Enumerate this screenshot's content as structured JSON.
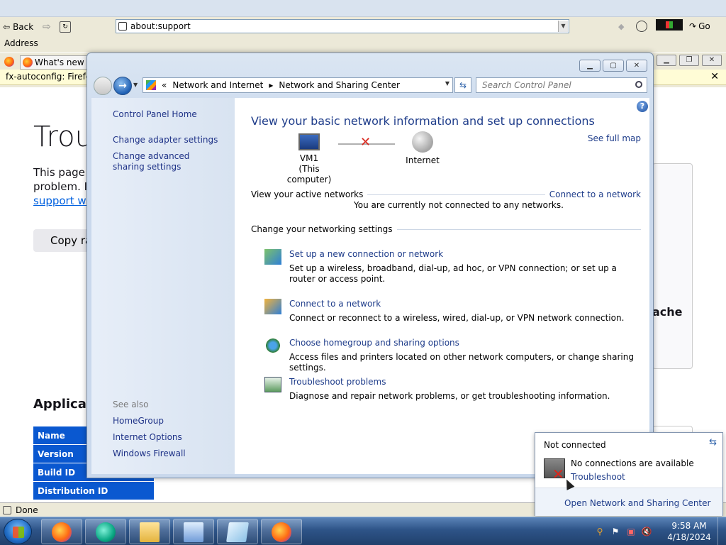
{
  "browser": {
    "back_label": "Back",
    "go_label": "Go",
    "address_label": "Address",
    "url": "about:support",
    "tab_title": "What's new w",
    "notification": "fx-autoconfig: Firefox",
    "status": "Done"
  },
  "support_page": {
    "title": "Troub",
    "intro_line1": "This page c",
    "intro_line2": "problem. If",
    "intro_link": "support we",
    "copy_button": "Copy ra",
    "right_panel_text": "ache",
    "section_heading": "Applicati",
    "table_rows": [
      "Name",
      "Version",
      "Build ID",
      "Distribution ID"
    ]
  },
  "control_panel": {
    "breadcrumb_prefix": "«",
    "breadcrumb": [
      "Network and Internet",
      "Network and Sharing Center"
    ],
    "search_placeholder": "Search Control Panel",
    "side_links": [
      "Control Panel Home",
      "Change adapter settings",
      "Change advanced sharing settings"
    ],
    "see_also_heading": "See also",
    "see_also_links": [
      "HomeGroup",
      "Internet Options",
      "Windows Firewall"
    ],
    "main_title": "View your basic network information and set up connections",
    "see_full_map": "See full map",
    "computer_name": "VM1",
    "computer_sub": "(This computer)",
    "internet_label": "Internet",
    "active_networks_label": "View your active networks",
    "connect_link": "Connect to a network",
    "not_connected_msg": "You are currently not connected to any networks.",
    "change_settings_label": "Change your networking settings",
    "tasks": [
      {
        "link": "Set up a new connection or network",
        "desc": "Set up a wireless, broadband, dial-up, ad hoc, or VPN connection; or set up a router or access point."
      },
      {
        "link": "Connect to a network",
        "desc": "Connect or reconnect to a wireless, wired, dial-up, or VPN network connection."
      },
      {
        "link": "Choose homegroup and sharing options",
        "desc": "Access files and printers located on other network computers, or change sharing settings."
      },
      {
        "link": "Troubleshoot problems",
        "desc": "Diagnose and repair network problems, or get troubleshooting information."
      }
    ]
  },
  "network_popup": {
    "title": "Not connected",
    "message": "No connections are available",
    "troubleshoot_link": "Troubleshoot",
    "footer_link": "Open Network and Sharing Center"
  },
  "taskbar": {
    "time": "9:58 AM",
    "date": "4/18/2024"
  },
  "colors": {
    "link": "#1e3c8a",
    "firefox_blue": "#0a58d0",
    "error_red": "#e0241a"
  }
}
